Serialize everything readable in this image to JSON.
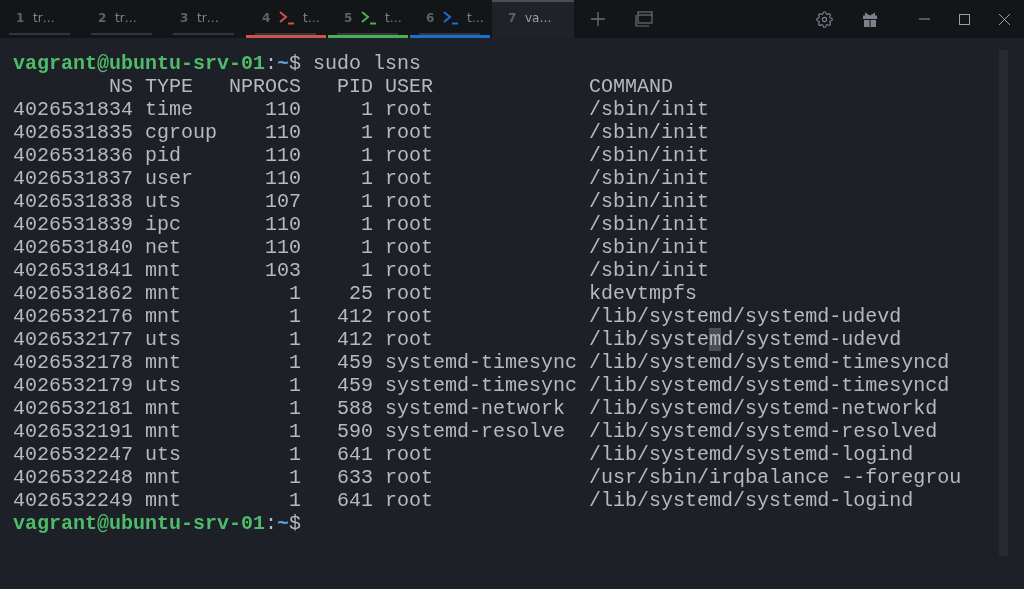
{
  "tabs": [
    {
      "number": "1",
      "label": "tr…",
      "kind": "plain",
      "selected": false
    },
    {
      "number": "2",
      "label": "tr…",
      "kind": "plain",
      "selected": false
    },
    {
      "number": "3",
      "label": "tr…",
      "kind": "plain",
      "selected": false
    },
    {
      "number": "4",
      "label": "t…",
      "kind": "shell",
      "color": "#d0524d",
      "selected": false
    },
    {
      "number": "5",
      "label": "t…",
      "kind": "shell",
      "color": "#4cb050",
      "selected": false
    },
    {
      "number": "6",
      "label": "t…",
      "kind": "shell",
      "color": "#1a6fd0",
      "selected": false
    },
    {
      "number": "7",
      "label": "va…",
      "kind": "plain",
      "selected": true
    }
  ],
  "terminal": {
    "lines": [
      {
        "kind": "prompt",
        "user": "vagrant@ubuntu-srv-01",
        "sep": ":",
        "path": "~",
        "symbol": "$",
        "command": " sudo lsns"
      },
      {
        "kind": "output",
        "text": "        NS TYPE   NPROCS   PID USER             COMMAND"
      },
      {
        "kind": "output",
        "text": "4026531834 time      110     1 root             /sbin/init"
      },
      {
        "kind": "output",
        "text": "4026531835 cgroup    110     1 root             /sbin/init"
      },
      {
        "kind": "output",
        "text": "4026531836 pid       110     1 root             /sbin/init"
      },
      {
        "kind": "output",
        "text": "4026531837 user      110     1 root             /sbin/init"
      },
      {
        "kind": "output",
        "text": "4026531838 uts       107     1 root             /sbin/init"
      },
      {
        "kind": "output",
        "text": "4026531839 ipc       110     1 root             /sbin/init"
      },
      {
        "kind": "output",
        "text": "4026531840 net       110     1 root             /sbin/init"
      },
      {
        "kind": "output",
        "text": "4026531841 mnt       103     1 root             /sbin/init"
      },
      {
        "kind": "output",
        "text": "4026531862 mnt         1    25 root             kdevtmpfs"
      },
      {
        "kind": "output",
        "text": "4026532176 mnt         1   412 root             /lib/systemd/systemd-udevd"
      },
      {
        "kind": "marked",
        "before": "4026532177 uts         1   412 root             /lib/syste",
        "marked": "m",
        "after": "d/systemd-udevd"
      },
      {
        "kind": "output",
        "text": "4026532178 mnt         1   459 systemd-timesync /lib/systemd/systemd-timesyncd"
      },
      {
        "kind": "output",
        "text": "4026532179 uts         1   459 systemd-timesync /lib/systemd/systemd-timesyncd"
      },
      {
        "kind": "output",
        "text": "4026532181 mnt         1   588 systemd-network  /lib/systemd/systemd-networkd"
      },
      {
        "kind": "output",
        "text": "4026532191 mnt         1   590 systemd-resolve  /lib/systemd/systemd-resolved"
      },
      {
        "kind": "output",
        "text": "4026532247 uts         1   641 root             /lib/systemd/systemd-logind"
      },
      {
        "kind": "output",
        "text": "4026532248 mnt         1   633 root             /usr/sbin/irqbalance --foregrou"
      },
      {
        "kind": "output",
        "text": "4026532249 mnt         1   641 root             /lib/systemd/systemd-logind"
      },
      {
        "kind": "prompt",
        "user": "vagrant@ubuntu-srv-01",
        "sep": ":",
        "path": "~",
        "symbol": "$"
      }
    ]
  }
}
